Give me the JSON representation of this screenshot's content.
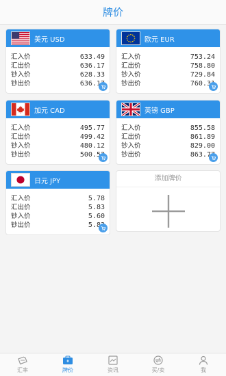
{
  "header": {
    "title": "牌价"
  },
  "row_labels": {
    "buy_transfer": "汇入价",
    "sell_transfer": "汇出价",
    "buy_cash": "钞入价",
    "sell_cash": "钞出价"
  },
  "currencies": [
    {
      "code": "usd",
      "name": "美元 USD",
      "flag": "us-flag-icon",
      "buy_transfer": "633.49",
      "sell_transfer": "636.17",
      "buy_cash": "628.33",
      "sell_cash": "636.17"
    },
    {
      "code": "eur",
      "name": "欧元 EUR",
      "flag": "eu-flag-icon",
      "buy_transfer": "753.24",
      "sell_transfer": "758.80",
      "buy_cash": "729.84",
      "sell_cash": "760.31"
    },
    {
      "code": "cad",
      "name": "加元 CAD",
      "flag": "ca-flag-icon",
      "buy_transfer": "495.77",
      "sell_transfer": "499.42",
      "buy_cash": "480.12",
      "sell_cash": "500.52"
    },
    {
      "code": "gbp",
      "name": "英镑 GBP",
      "flag": "gb-flag-icon",
      "buy_transfer": "855.58",
      "sell_transfer": "861.89",
      "buy_cash": "829.00",
      "sell_cash": "863.77"
    },
    {
      "code": "jpy",
      "name": "日元 JPY",
      "flag": "jp-flag-icon",
      "buy_transfer": "5.78",
      "sell_transfer": "5.83",
      "buy_cash": "5.60",
      "sell_cash": "5.83"
    }
  ],
  "add_card": {
    "label": "添加牌价",
    "icon": "plus-icon"
  },
  "tabs": [
    {
      "label": "汇率",
      "icon": "exchange-rate-icon",
      "active": false
    },
    {
      "label": "牌价",
      "icon": "price-board-icon",
      "active": true
    },
    {
      "label": "资讯",
      "icon": "news-icon",
      "active": false
    },
    {
      "label": "买/卖",
      "icon": "trade-icon",
      "active": false
    },
    {
      "label": "我",
      "icon": "profile-icon",
      "active": false
    }
  ],
  "colors": {
    "accent": "#2e8de2",
    "card_header": "#2f92e8",
    "tab_inactive": "#999999"
  }
}
